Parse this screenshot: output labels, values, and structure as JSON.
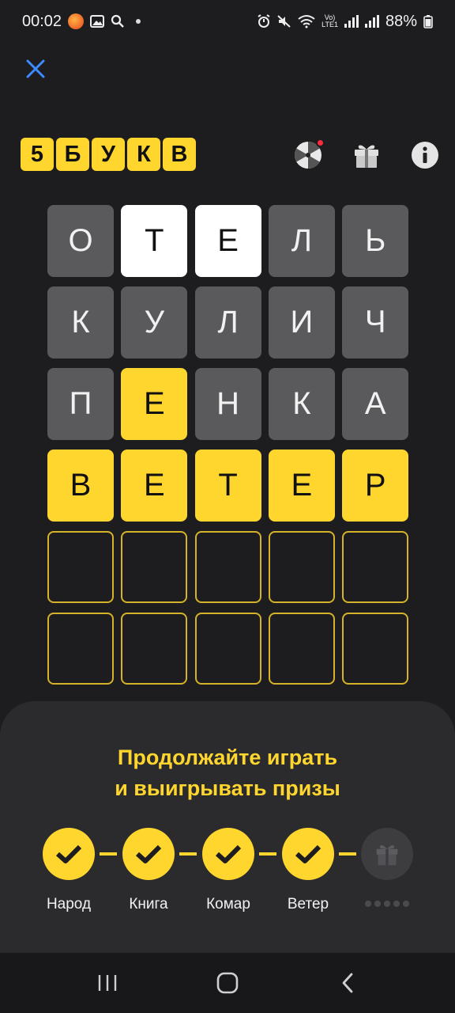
{
  "status_bar": {
    "time": "00:02",
    "battery": "88%",
    "network": "LTE1"
  },
  "header": {
    "logo_letters": [
      "5",
      "Б",
      "У",
      "К",
      "В"
    ],
    "icons": [
      "wheel-icon",
      "gift-icon",
      "info-icon"
    ],
    "accent_color": "#ffd62e"
  },
  "grid": {
    "rows": [
      [
        {
          "letter": "О",
          "state": "absent"
        },
        {
          "letter": "Т",
          "state": "correct"
        },
        {
          "letter": "Е",
          "state": "correct"
        },
        {
          "letter": "Л",
          "state": "absent"
        },
        {
          "letter": "Ь",
          "state": "absent"
        }
      ],
      [
        {
          "letter": "К",
          "state": "absent"
        },
        {
          "letter": "У",
          "state": "absent"
        },
        {
          "letter": "Л",
          "state": "absent"
        },
        {
          "letter": "И",
          "state": "absent"
        },
        {
          "letter": "Ч",
          "state": "absent"
        }
      ],
      [
        {
          "letter": "П",
          "state": "absent"
        },
        {
          "letter": "Е",
          "state": "present"
        },
        {
          "letter": "Н",
          "state": "absent"
        },
        {
          "letter": "К",
          "state": "absent"
        },
        {
          "letter": "А",
          "state": "absent"
        }
      ],
      [
        {
          "letter": "В",
          "state": "win"
        },
        {
          "letter": "Е",
          "state": "win"
        },
        {
          "letter": "Т",
          "state": "win"
        },
        {
          "letter": "Е",
          "state": "win"
        },
        {
          "letter": "Р",
          "state": "win"
        }
      ],
      [
        {
          "letter": "",
          "state": "empty"
        },
        {
          "letter": "",
          "state": "empty"
        },
        {
          "letter": "",
          "state": "empty"
        },
        {
          "letter": "",
          "state": "empty"
        },
        {
          "letter": "",
          "state": "empty"
        }
      ],
      [
        {
          "letter": "",
          "state": "empty"
        },
        {
          "letter": "",
          "state": "empty"
        },
        {
          "letter": "",
          "state": "empty"
        },
        {
          "letter": "",
          "state": "empty"
        },
        {
          "letter": "",
          "state": "empty"
        }
      ]
    ]
  },
  "sheet": {
    "title_line1": "Продолжайте играть",
    "title_line2": "и выигрывать призы",
    "steps": [
      {
        "label": "Народ",
        "state": "done"
      },
      {
        "label": "Книга",
        "state": "done"
      },
      {
        "label": "Комар",
        "state": "done"
      },
      {
        "label": "Ветер",
        "state": "done"
      },
      {
        "label": "",
        "state": "locked"
      }
    ]
  },
  "colors": {
    "background": "#1d1d1f",
    "sheet": "#2b2b2d",
    "absent": "#5a5a5c",
    "correct": "#ffffff",
    "present": "#ffd62e"
  }
}
